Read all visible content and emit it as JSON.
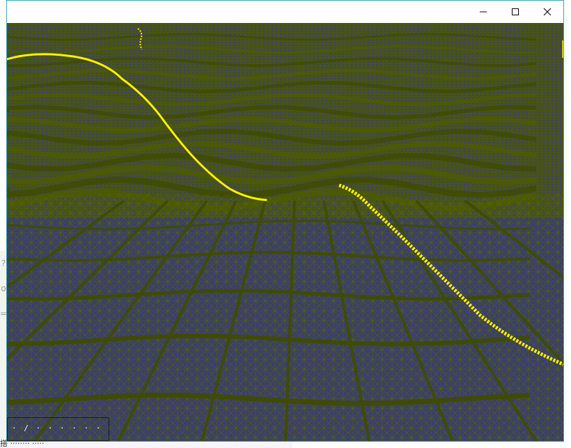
{
  "window": {
    "title": "",
    "controls": {
      "minimize": "minimize",
      "maximize": "maximize",
      "close": "close"
    }
  },
  "viewport": {
    "content": "3D wireframe terrain mesh",
    "colors": {
      "background": "#3a3f6a",
      "mesh": "#4d5a00",
      "mesh_dark": "#3f4b00",
      "path": "#fff200"
    },
    "overlay_text": "· / · · · · · · · ·"
  },
  "background_window": {
    "left_glyphs": [
      "?",
      "o",
      "="
    ],
    "bottom_text": "搭 ········ ·····"
  }
}
